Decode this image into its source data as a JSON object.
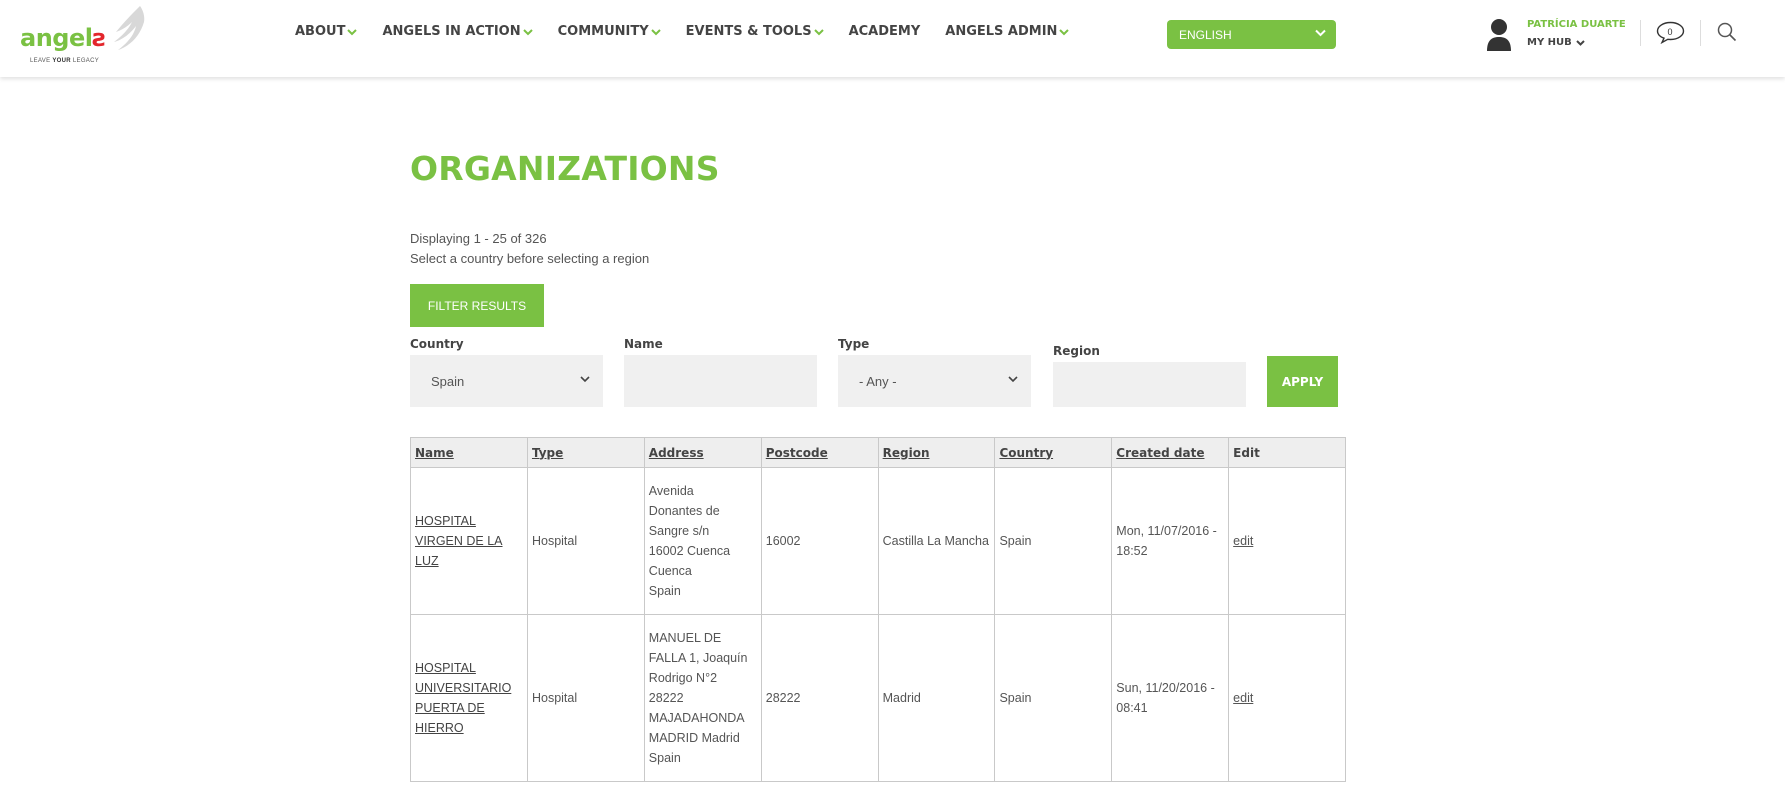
{
  "header": {
    "logo": {
      "word": "angel",
      "word_end": "s",
      "tagline_pre": "LEAVE",
      "tagline_bold": "YOUR",
      "tagline_post": "LEGACY"
    },
    "nav": [
      {
        "label": "ABOUT",
        "dropdown": true
      },
      {
        "label": "ANGELS IN ACTION",
        "dropdown": true
      },
      {
        "label": "COMMUNITY",
        "dropdown": true
      },
      {
        "label": "EVENTS & TOOLS",
        "dropdown": true
      },
      {
        "label": "ACADEMY",
        "dropdown": false
      },
      {
        "label": "ANGELS ADMIN",
        "dropdown": true
      }
    ],
    "language": "ENGLISH",
    "user_name": "PATRÍCIA DUARTE",
    "hub_label": "MY HUB",
    "message_count": "0"
  },
  "colors": {
    "brand_green": "#7ac143",
    "brand_red": "#e3262c"
  },
  "page": {
    "title": "ORGANIZATIONS",
    "displaying": "Displaying 1 - 25 of 326",
    "hint": "Select a country before selecting a region",
    "filter_button": "FILTER RESULTS",
    "apply_button": "APPLY"
  },
  "filters": {
    "country": {
      "label": "Country",
      "value": "Spain"
    },
    "name": {
      "label": "Name",
      "value": ""
    },
    "type": {
      "label": "Type",
      "value": "- Any -"
    },
    "region": {
      "label": "Region",
      "value": ""
    }
  },
  "table": {
    "columns": [
      "Name",
      "Type",
      "Address",
      "Postcode",
      "Region",
      "Country",
      "Created date",
      "Edit"
    ],
    "rows": [
      {
        "name": "HOSPITAL VIRGEN DE LA LUZ",
        "type": "Hospital",
        "address": [
          "Avenida",
          "Donantes de",
          "Sangre s/n",
          "16002 Cuenca",
          "Cuenca",
          "Spain"
        ],
        "postcode": "16002",
        "region": "Castilla La Mancha",
        "country": "Spain",
        "created": "Mon, 11/07/2016 - 18:52",
        "edit": "edit"
      },
      {
        "name": "HOSPITAL UNIVERSITARIO PUERTA DE HIERRO",
        "type": "Hospital",
        "address": [
          "MANUEL DE",
          "FALLA 1, Joaquín",
          "Rodrigo N°2",
          "28222",
          "MAJADAHONDA",
          "MADRID Madrid",
          "Spain"
        ],
        "postcode": "28222",
        "region": "Madrid",
        "country": "Spain",
        "created": "Sun, 11/20/2016 - 08:41",
        "edit": "edit"
      }
    ]
  }
}
